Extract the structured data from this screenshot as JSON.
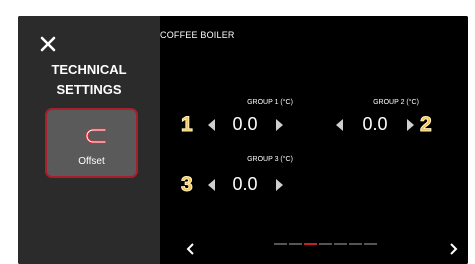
{
  "sidebar": {
    "title_line1": "TECHNICAL",
    "title_line2": "SETTINGS",
    "close_icon": "close-icon",
    "offset": {
      "label": "Offset",
      "icon": "offset-icon"
    }
  },
  "header": {
    "title": "COFFEE BOILER"
  },
  "groups": [
    {
      "label": "GROUP 1 (°C)",
      "value": "0.0",
      "badge": "1"
    },
    {
      "label": "GROUP 2 (°C)",
      "value": "0.0",
      "badge": "2"
    },
    {
      "label": "GROUP 3 (°C)",
      "value": "0.0",
      "badge": "3"
    }
  ],
  "pager": {
    "count": 8,
    "active_index": 2
  },
  "colors": {
    "accent": "#c3202f",
    "badge": "#f7c24b",
    "sidebar": "#2b2b2b"
  }
}
